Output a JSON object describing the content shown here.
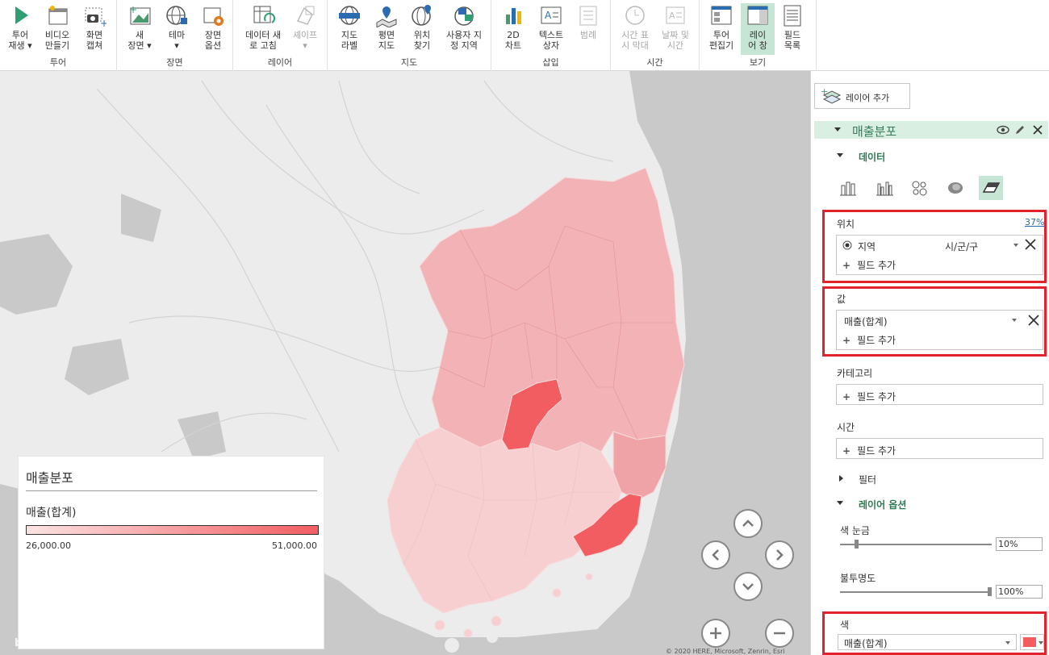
{
  "ribbon": {
    "groups": [
      {
        "label": "투어",
        "buttons": [
          {
            "label": "투어\n재생 ▾",
            "icon": "play-icon"
          },
          {
            "label": "비디오\n만들기",
            "icon": "video-icon"
          },
          {
            "label": "화면\n캡쳐",
            "icon": "camera-icon"
          }
        ]
      },
      {
        "label": "장면",
        "buttons": [
          {
            "label": "새\n장면 ▾",
            "icon": "new-scene-icon"
          },
          {
            "label": "테마\n▾",
            "icon": "theme-globe-icon"
          },
          {
            "label": "장면\n옵션",
            "icon": "scene-options-icon"
          }
        ]
      },
      {
        "label": "레이어",
        "buttons": [
          {
            "label": "데이터 새\n로 고침",
            "icon": "refresh-data-icon"
          },
          {
            "label": "셰이프\n▾",
            "icon": "shape-icon",
            "disabled": true
          }
        ]
      },
      {
        "label": "지도",
        "buttons": [
          {
            "label": "지도\n라벨",
            "icon": "map-labels-icon"
          },
          {
            "label": "평면\n지도",
            "icon": "flat-map-icon"
          },
          {
            "label": "위치\n찾기",
            "icon": "find-location-icon"
          },
          {
            "label": "사용자 지\n정 지역",
            "icon": "custom-regions-icon"
          }
        ]
      },
      {
        "label": "삽입",
        "buttons": [
          {
            "label": "2D\n차트",
            "icon": "2d-chart-icon"
          },
          {
            "label": "텍스트\n상자",
            "icon": "text-box-icon"
          },
          {
            "label": "범례",
            "icon": "legend-icon",
            "disabled": true
          }
        ]
      },
      {
        "label": "시간",
        "buttons": [
          {
            "label": "시간 표\n시 막대",
            "icon": "timeline-icon",
            "disabled": true
          },
          {
            "label": "날짜 및\n시간",
            "icon": "date-time-icon",
            "disabled": true
          }
        ]
      },
      {
        "label": "보기",
        "buttons": [
          {
            "label": "투어\n편집기",
            "icon": "tour-editor-icon"
          },
          {
            "label": "레이\n어 창",
            "icon": "layer-pane-icon",
            "active": true
          },
          {
            "label": "필드\n목록",
            "icon": "field-list-icon"
          }
        ]
      }
    ]
  },
  "legend": {
    "title": "매출분포",
    "field": "매출(합계)",
    "min": "26,000.00",
    "max": "51,000.00"
  },
  "map": {
    "attribution": "bing",
    "copyright": "© 2020 HERE, Microsoft, Zenrin, Esri"
  },
  "pane": {
    "add_layer": "레이어 추가",
    "layer_name": "매출분포",
    "data_section": "데이터",
    "location": {
      "label": "위치",
      "percent": "37%",
      "field": "지역",
      "type": "시/군/구",
      "add": "필드 추가"
    },
    "value": {
      "label": "값",
      "field": "매출(합계)",
      "add": "필드 추가"
    },
    "category": {
      "label": "카테고리",
      "add": "필드 추가"
    },
    "time": {
      "label": "시간",
      "add": "필드 추가"
    },
    "filter": "필터",
    "layer_options": "레이어 옵션",
    "color_scale": {
      "label": "색 눈금",
      "value": "10%"
    },
    "opacity": {
      "label": "불투명도",
      "value": "100%"
    },
    "color": {
      "label": "색",
      "value": "매출(합계)"
    },
    "accent": "#e0232c",
    "swatch": "#f25d62"
  }
}
